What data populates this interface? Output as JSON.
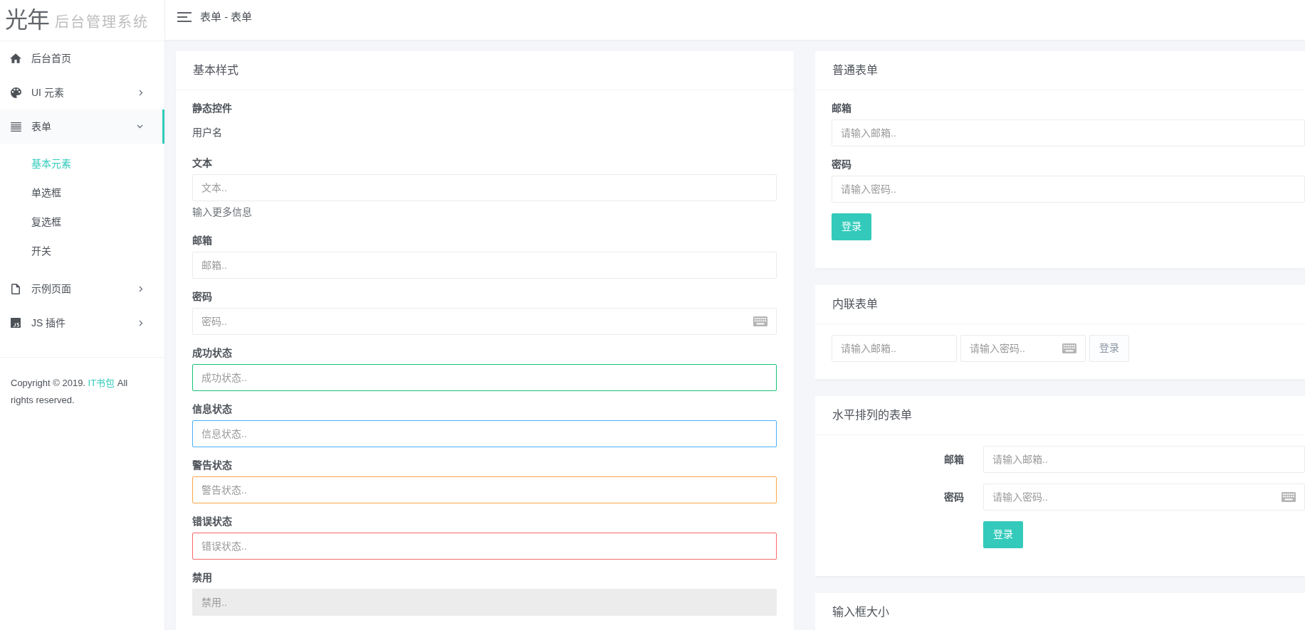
{
  "sidebar": {
    "logo": {
      "mark": "光年",
      "subtitle": "后台管理系统"
    },
    "items": [
      {
        "label": "后台首页",
        "selected": false
      },
      {
        "label": "UI 元素",
        "selected": false,
        "expanded": false
      },
      {
        "label": "表单",
        "selected": true,
        "expanded": true,
        "children": [
          {
            "label": "基本元素",
            "selected": true
          },
          {
            "label": "单选框",
            "selected": false
          },
          {
            "label": "复选框",
            "selected": false
          },
          {
            "label": "开关",
            "selected": false
          }
        ]
      },
      {
        "label": "示例页面",
        "selected": false,
        "expanded": false
      },
      {
        "label": "JS 插件",
        "selected": false,
        "expanded": false
      }
    ],
    "footer": {
      "prefix": "Copyright © 2019.",
      "link": "IT书包",
      "suffix": "All rights reserved."
    }
  },
  "header": {
    "title": "表单 - 表单"
  },
  "left_column": [
    {
      "title": "基本样式",
      "kind": "stacked",
      "fields": [
        {
          "kind": "static",
          "label": "静态控件",
          "value": "用户名"
        },
        {
          "kind": "text",
          "label": "文本",
          "placeholder": "文本..",
          "help": "输入更多信息",
          "disabled": false
        },
        {
          "kind": "text",
          "label": "邮箱",
          "placeholder": "邮箱..",
          "disabled": false
        },
        {
          "kind": "password",
          "label": "密码",
          "placeholder": "密码..",
          "disabled": false
        },
        {
          "kind": "text",
          "label": "成功状态",
          "placeholder": "成功状态..",
          "color": "#15c377",
          "disabled": false
        },
        {
          "kind": "text",
          "label": "信息状态",
          "placeholder": "信息状态..",
          "color": "#48b0f7",
          "disabled": false
        },
        {
          "kind": "text",
          "label": "警告状态",
          "placeholder": "警告状态..",
          "color": "#faa64b",
          "disabled": false
        },
        {
          "kind": "text",
          "label": "错误状态",
          "placeholder": "错误状态..",
          "color": "#f96868",
          "disabled": false
        },
        {
          "kind": "text",
          "label": "禁用",
          "placeholder": "禁用..",
          "disabled": true
        }
      ]
    }
  ],
  "right_column": [
    {
      "title": "普通表单",
      "kind": "stacked",
      "fields": [
        {
          "kind": "text",
          "label": "邮箱",
          "placeholder": "请输入邮箱..",
          "disabled": false
        },
        {
          "kind": "text",
          "label": "密码",
          "placeholder": "请输入密码..",
          "disabled": false
        }
      ],
      "button": {
        "label": "登录",
        "kind": "primary"
      }
    },
    {
      "title": "内联表单",
      "kind": "inline",
      "fields": [
        {
          "kind": "text",
          "placeholder": "请输入邮箱..",
          "disabled": false
        },
        {
          "kind": "password",
          "placeholder": "请输入密码..",
          "disabled": false
        }
      ],
      "button": {
        "label": "登录",
        "kind": "default"
      }
    },
    {
      "title": "水平排列的表单",
      "kind": "horizontal",
      "fields": [
        {
          "kind": "text",
          "label": "邮箱",
          "placeholder": "请输入邮箱..",
          "disabled": false
        },
        {
          "kind": "password",
          "label": "密码",
          "placeholder": "请输入密码..",
          "disabled": false
        }
      ],
      "button": {
        "label": "登录",
        "kind": "primary"
      }
    },
    {
      "title": "输入框大小"
    }
  ]
}
